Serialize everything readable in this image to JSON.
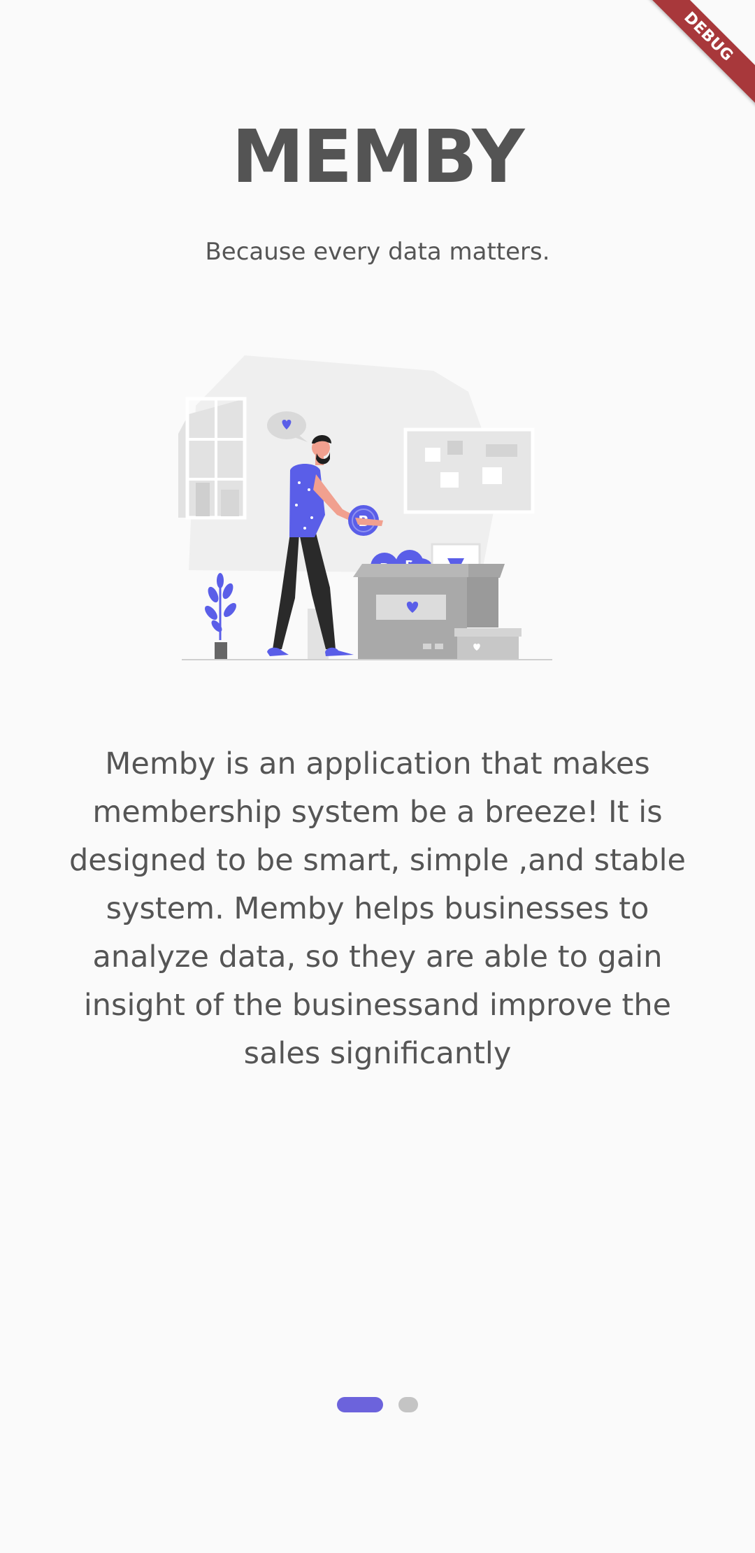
{
  "debug_banner": {
    "label": "DEBUG"
  },
  "header": {
    "title": "MEMBY",
    "tagline": "Because every data matters."
  },
  "illustration": {
    "icon": "membership-boxes-illustration",
    "coin_symbol": "B",
    "accent_color": "#5a5ee8"
  },
  "description": {
    "text": "Memby is an application that makes membership system be a breeze! It is designed to be smart, simple ,and stable system. Memby helps businesses to analyze data, so they are able to gain insight of the businessand improve the sales significantly"
  },
  "pager": {
    "page_count": 2,
    "current_page": 1,
    "active_color": "#6c63dc",
    "inactive_color": "#c4c4c4"
  }
}
